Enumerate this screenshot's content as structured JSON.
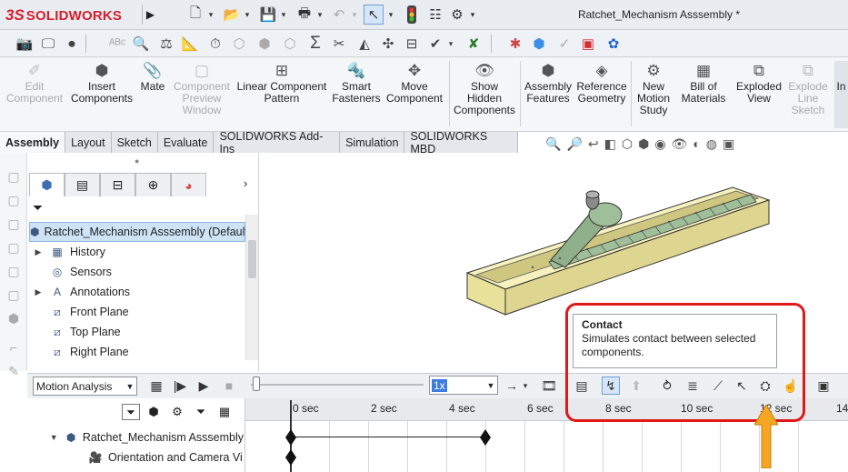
{
  "app": {
    "logo_prefix": "3S",
    "logo_text": "SOLIDWORKS",
    "document_title": "Ratchet_Mechanism Asssembly *"
  },
  "command_manager": [
    {
      "label": "Edit\nComponent",
      "icon": "edit-component-icon",
      "enabled": false
    },
    {
      "label": "Insert\nComponents",
      "icon": "insert-components-icon",
      "enabled": true
    },
    {
      "label": "Mate",
      "icon": "mate-paperclip-icon",
      "enabled": true
    },
    {
      "label": "Component\nPreview\nWindow",
      "icon": "preview-window-icon",
      "enabled": false
    },
    {
      "label": "Linear Component\nPattern",
      "icon": "linear-pattern-icon",
      "enabled": true
    },
    {
      "label": "Smart\nFasteners",
      "icon": "smart-fasteners-icon",
      "enabled": true
    },
    {
      "label": "Move\nComponent",
      "icon": "move-component-icon",
      "enabled": true
    },
    {
      "label": "Show\nHidden\nComponents",
      "icon": "show-hidden-icon",
      "enabled": true
    },
    {
      "label": "Assembly\nFeatures",
      "icon": "assembly-features-icon",
      "enabled": true
    },
    {
      "label": "Reference\nGeometry",
      "icon": "reference-geometry-icon",
      "enabled": true
    },
    {
      "label": "New\nMotion\nStudy",
      "icon": "motion-study-icon",
      "enabled": true
    },
    {
      "label": "Bill of\nMaterials",
      "icon": "bom-icon",
      "enabled": true
    },
    {
      "label": "Exploded\nView",
      "icon": "exploded-view-icon",
      "enabled": true
    },
    {
      "label": "Explode\nLine\nSketch",
      "icon": "explode-line-icon",
      "enabled": false
    },
    {
      "label": "In",
      "icon": "instant3d-icon",
      "enabled": true
    }
  ],
  "tabs": [
    "Assembly",
    "Layout",
    "Sketch",
    "Evaluate",
    "SOLIDWORKS Add-Ins",
    "Simulation",
    "SOLIDWORKS MBD"
  ],
  "active_tab": "Assembly",
  "feature_tree": {
    "root": "Ratchet_Mechanism Asssembly  (Default",
    "items": [
      {
        "label": "History",
        "icon": "history-folder-icon",
        "expandable": true
      },
      {
        "label": "Sensors",
        "icon": "sensors-icon",
        "expandable": false
      },
      {
        "label": "Annotations",
        "icon": "annotations-icon",
        "expandable": true
      },
      {
        "label": "Front Plane",
        "icon": "plane-icon",
        "expandable": false
      },
      {
        "label": "Top Plane",
        "icon": "plane-icon",
        "expandable": false
      },
      {
        "label": "Right Plane",
        "icon": "plane-icon",
        "expandable": false
      }
    ]
  },
  "motion": {
    "study_type": "Motion Analysis",
    "playback_speed": "1x",
    "time_labels": [
      "0 sec",
      "2 sec",
      "4 sec",
      "6 sec",
      "8 sec",
      "10 sec",
      "12 sec",
      "14"
    ],
    "tree": [
      {
        "label": "Ratchet_Mechanism Asssembly",
        "icon": "assembly-icon"
      },
      {
        "label": "Orientation and Camera Vi",
        "icon": "camera-icon"
      }
    ]
  },
  "tooltip": {
    "title": "Contact",
    "body": "Simulates contact between selected components."
  },
  "colors": {
    "highlight_red": "#e01818",
    "arrow_orange": "#f5a623",
    "part_yellow": "#f2ecae",
    "part_green": "#9fbe9a"
  }
}
